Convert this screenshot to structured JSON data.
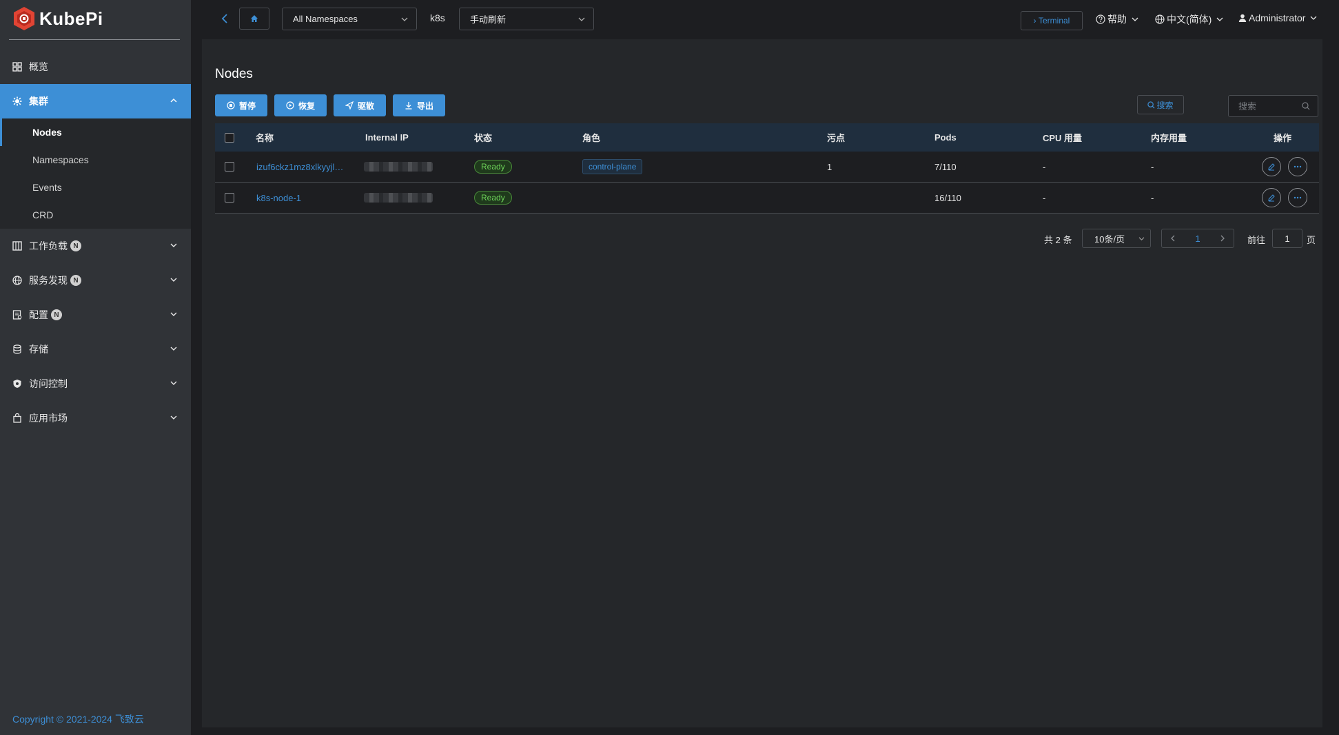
{
  "app": {
    "logo_text": "KubePi",
    "copyright": "Copyright © 2021-2024 飞致云"
  },
  "sidebar": {
    "items": [
      {
        "label": "概览",
        "icon": "dashboard-icon"
      },
      {
        "label": "集群",
        "icon": "cluster-icon",
        "active": true
      },
      {
        "label": "工作负载",
        "icon": "workload-icon",
        "badge": "N"
      },
      {
        "label": "服务发现",
        "icon": "globe-icon",
        "badge": "N"
      },
      {
        "label": "配置",
        "icon": "config-icon",
        "badge": "N"
      },
      {
        "label": "存储",
        "icon": "database-icon"
      },
      {
        "label": "访问控制",
        "icon": "shield-icon"
      },
      {
        "label": "应用市场",
        "icon": "bag-icon"
      }
    ],
    "cluster_sub": [
      "Nodes",
      "Namespaces",
      "Events",
      "CRD"
    ]
  },
  "topbar": {
    "namespace": "All Namespaces",
    "cluster": "k8s",
    "refresh": "手动刷新",
    "terminal": "Terminal",
    "help": "帮助",
    "language": "中文(简体)",
    "user": "Administrator"
  },
  "page": {
    "title": "Nodes",
    "actions": [
      "暂停",
      "恢复",
      "驱散",
      "导出"
    ],
    "search_button": "搜索",
    "search_placeholder": "搜索"
  },
  "table": {
    "headers": [
      "名称",
      "Internal IP",
      "状态",
      "角色",
      "污点",
      "Pods",
      "CPU 用量",
      "内存用量",
      "操作"
    ],
    "rows": [
      {
        "name": "izuf6ckz1mz8xlkyyjl…",
        "status": "Ready",
        "role": "control-plane",
        "taints": "1",
        "pods": "7/110",
        "cpu": "-",
        "mem": "-"
      },
      {
        "name": "k8s-node-1",
        "status": "Ready",
        "role": "",
        "taints": "",
        "pods": "16/110",
        "cpu": "-",
        "mem": "-"
      }
    ]
  },
  "pagination": {
    "total": "共 2 条",
    "page_size": "10条/页",
    "current": "1",
    "goto_prefix": "前往",
    "goto_value": "1",
    "goto_suffix": "页"
  },
  "colors": {
    "accent": "#3d8fd6",
    "sidebar_bg": "#303337",
    "ready_green": "#6ed45a"
  }
}
